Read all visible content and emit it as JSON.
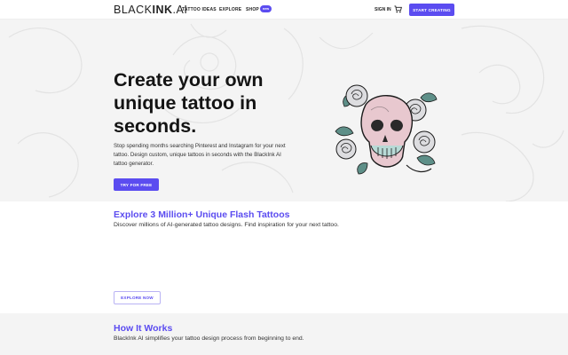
{
  "brand": {
    "part1": "BLACK",
    "part2": "INK",
    "part3": ".AI"
  },
  "nav": {
    "links": [
      "TATTOO IDEAS",
      "EXPLORE",
      "SHOP"
    ],
    "shop_badge": "new",
    "signin": "SIGN IN",
    "cart_icon": "cart-icon",
    "cta": "START CREATING"
  },
  "hero": {
    "title_lines": [
      "Create your own",
      "unique tattoo in",
      "seconds."
    ],
    "description_lines": [
      "Stop spending months searching Pinterest and Instagram for your next",
      "tattoo. Design custom, unique tattoos in seconds with the BlackInk AI",
      "tattoo generator."
    ],
    "button": "TRY FOR FREE",
    "image": "skull-roses-tattoo-illustration"
  },
  "explore": {
    "title": "Explore 3 Million+ Unique Flash Tattoos",
    "subtitle": "Discover millions of AI-generated tattoo designs. Find inspiration for your next tattoo.",
    "button": "EXPLORE NOW"
  },
  "how": {
    "title": "How It Works",
    "subtitle": "BlackInk AI simplifies your tattoo design process from beginning to end."
  },
  "colors": {
    "accent": "#5b4cf0",
    "hero_bg": "#f4f4f4",
    "text": "#141414"
  }
}
